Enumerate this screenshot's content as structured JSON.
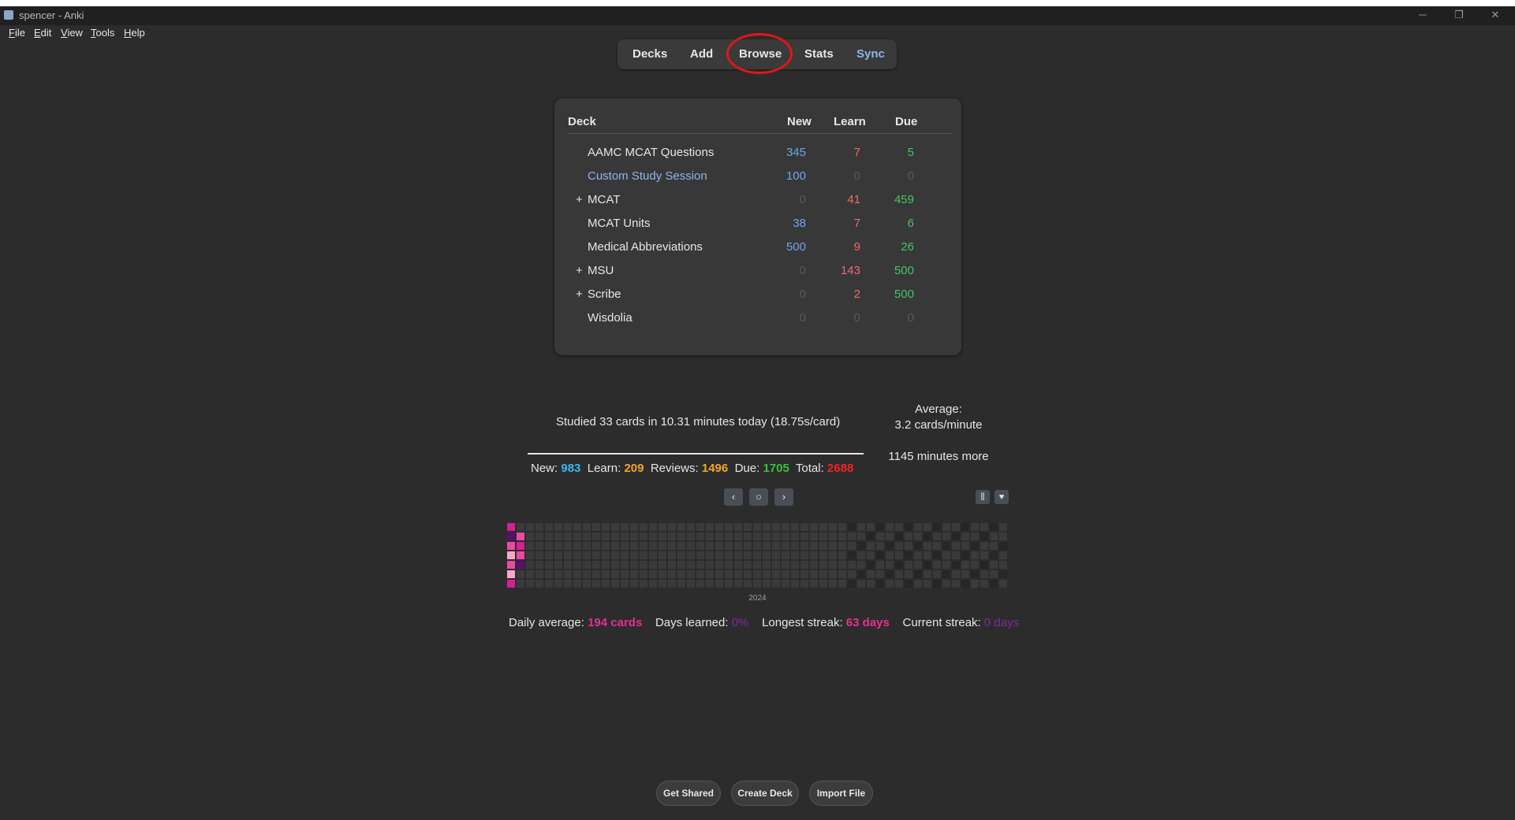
{
  "window": {
    "title": "spencer - Anki",
    "minimize": "─",
    "maximize": "❐",
    "close": "✕"
  },
  "menu": [
    {
      "key": "F",
      "rest": "ile"
    },
    {
      "key": "E",
      "rest": "dit"
    },
    {
      "key": "V",
      "rest": "iew"
    },
    {
      "key": "T",
      "rest": "ools"
    },
    {
      "key": "H",
      "rest": "elp"
    }
  ],
  "nav": {
    "decks": "Decks",
    "add": "Add",
    "browse": "Browse",
    "stats": "Stats",
    "sync": "Sync"
  },
  "deck_table": {
    "headers": {
      "deck": "Deck",
      "new": "New",
      "learn": "Learn",
      "due": "Due"
    },
    "rows": [
      {
        "expander": "",
        "name": "AAMC MCAT Questions",
        "new": "345",
        "learn": "7",
        "due": "5",
        "current": false
      },
      {
        "expander": "",
        "name": "Custom Study Session",
        "new": "100",
        "learn": "0",
        "due": "0",
        "current": true
      },
      {
        "expander": "+",
        "name": "MCAT",
        "new": "0",
        "learn": "41",
        "due": "459",
        "current": false
      },
      {
        "expander": "",
        "name": "MCAT Units",
        "new": "38",
        "learn": "7",
        "due": "6",
        "current": false
      },
      {
        "expander": "",
        "name": "Medical Abbreviations",
        "new": "500",
        "learn": "9",
        "due": "26",
        "current": false
      },
      {
        "expander": "+",
        "name": "MSU",
        "new": "0",
        "learn": "143",
        "due": "500",
        "current": false
      },
      {
        "expander": "+",
        "name": "Scribe",
        "new": "0",
        "learn": "2",
        "due": "500",
        "current": false
      },
      {
        "expander": "",
        "name": "Wisdolia",
        "new": "0",
        "learn": "0",
        "due": "0",
        "current": false
      }
    ]
  },
  "study": {
    "studied_text": "Studied 33 cards in 10.31 minutes today (18.75s/card)",
    "average_label": "Average:",
    "average_value": "3.2 cards/minute",
    "minutes_more": "1145 minutes more",
    "counts": {
      "new_label": "New:",
      "new_value": "983",
      "learn_label": "Learn:",
      "learn_value": "209",
      "reviews_label": "Reviews:",
      "reviews_value": "1496",
      "due_label": "Due:",
      "due_value": "1705",
      "total_label": "Total:",
      "total_value": "2688"
    }
  },
  "heatmap": {
    "prev": "‹",
    "today": "○",
    "next": "›",
    "options_icon": "⫼",
    "heart_icon": "♥",
    "year_label": "2024",
    "colors": {
      "empty": "#3a3a3a",
      "past": "#262626",
      "level1": "#f6a8c8",
      "level2": "#ea4aa0",
      "level3": "#d61e95",
      "level4": "#5a0f6e"
    },
    "daily_average_label": "Daily average:",
    "daily_average_value": "194 cards",
    "days_learned_label": "Days learned:",
    "days_learned_value": "0%",
    "longest_streak_label": "Longest streak:",
    "longest_streak_value": "63 days",
    "current_streak_label": "Current streak:",
    "current_streak_value": "0 days"
  },
  "bottom": {
    "get_shared": "Get Shared",
    "create_deck": "Create Deck",
    "import_file": "Import File"
  }
}
